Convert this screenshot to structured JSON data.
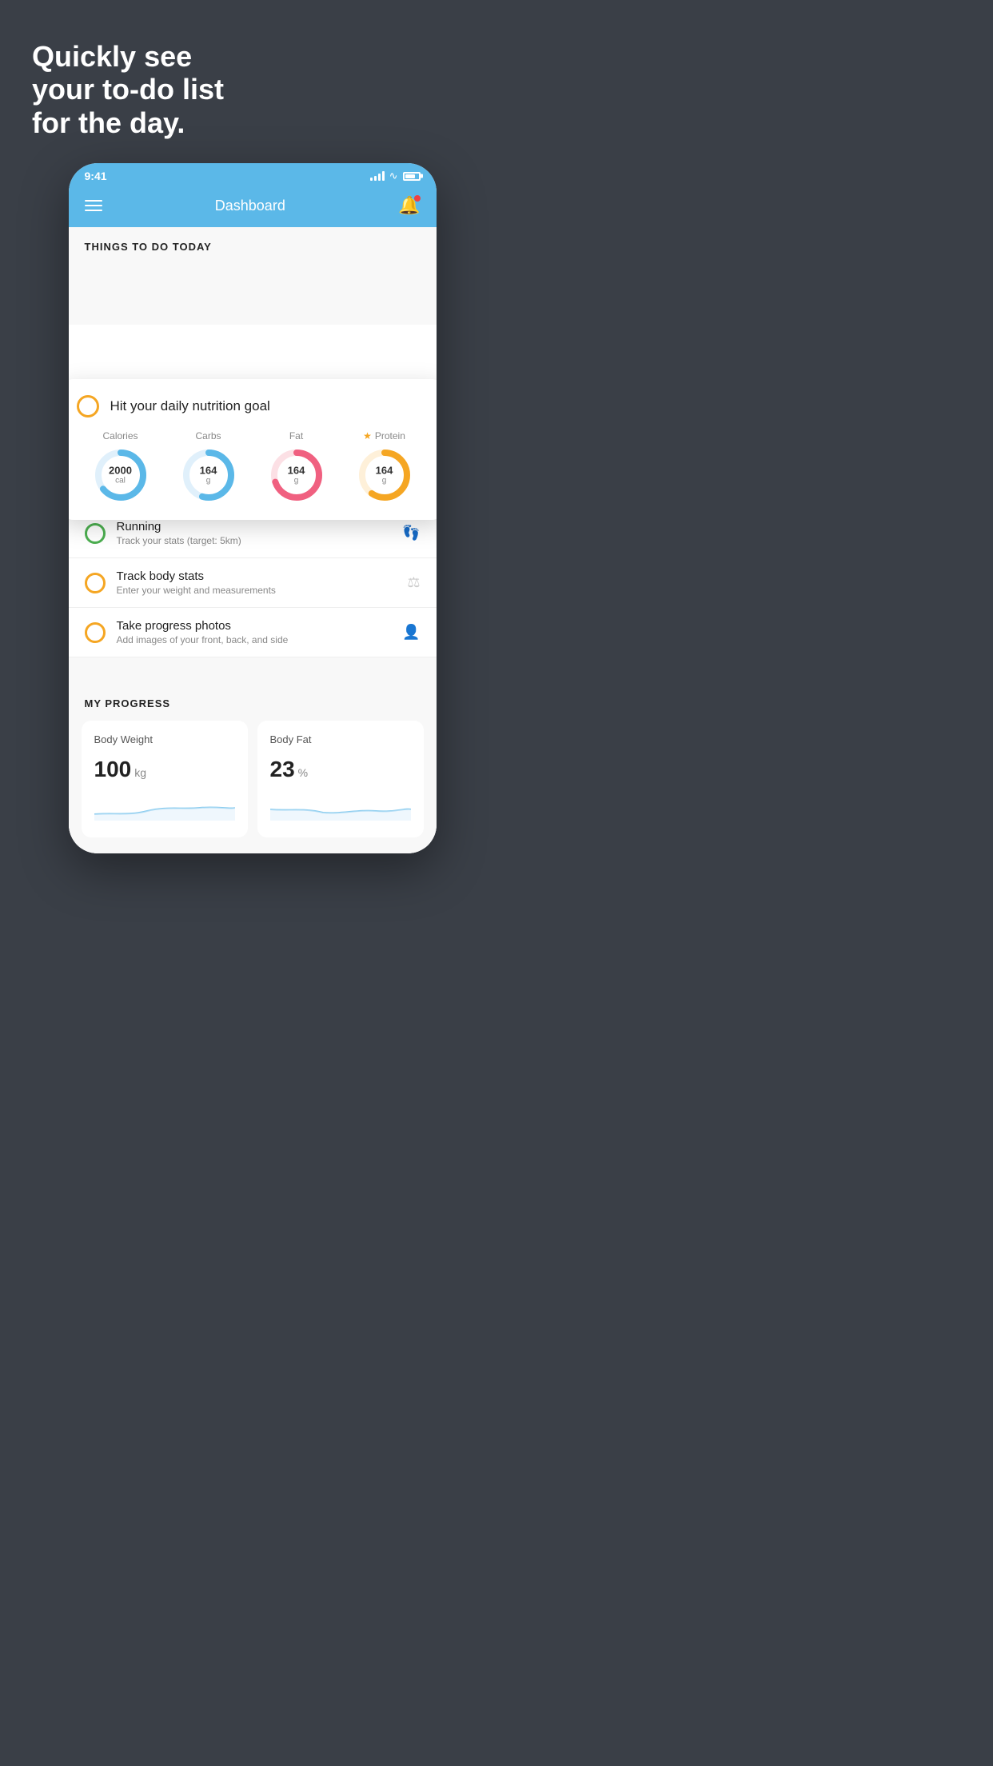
{
  "background": {
    "headline": "Quickly see\nyour to-do list\nfor the day."
  },
  "statusBar": {
    "time": "9:41"
  },
  "header": {
    "title": "Dashboard"
  },
  "thingsToDo": {
    "sectionTitle": "THINGS TO DO TODAY",
    "floatingCard": {
      "title": "Hit your daily nutrition goal",
      "items": [
        {
          "label": "Calories",
          "value": "2000",
          "unit": "cal",
          "color": "#5bb8e8",
          "trackColor": "#e0f0fb",
          "percent": 65
        },
        {
          "label": "Carbs",
          "value": "164",
          "unit": "g",
          "color": "#5bb8e8",
          "trackColor": "#e0f0fb",
          "percent": 55
        },
        {
          "label": "Fat",
          "value": "164",
          "unit": "g",
          "color": "#f06080",
          "trackColor": "#fce0e5",
          "percent": 70
        },
        {
          "label": "Protein",
          "value": "164",
          "unit": "g",
          "color": "#f5a623",
          "trackColor": "#fef0d9",
          "percent": 60,
          "star": true
        }
      ]
    },
    "todoItems": [
      {
        "title": "Running",
        "subtitle": "Track your stats (target: 5km)",
        "circleColor": "green",
        "iconType": "shoe"
      },
      {
        "title": "Track body stats",
        "subtitle": "Enter your weight and measurements",
        "circleColor": "yellow",
        "iconType": "scale"
      },
      {
        "title": "Take progress photos",
        "subtitle": "Add images of your front, back, and side",
        "circleColor": "yellow",
        "iconType": "person"
      }
    ]
  },
  "myProgress": {
    "sectionTitle": "MY PROGRESS",
    "cards": [
      {
        "title": "Body Weight",
        "value": "100",
        "unit": "kg"
      },
      {
        "title": "Body Fat",
        "value": "23",
        "unit": "%"
      }
    ]
  }
}
